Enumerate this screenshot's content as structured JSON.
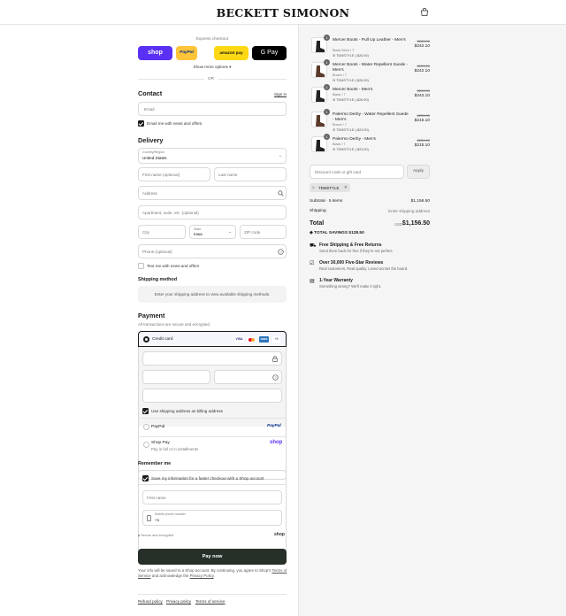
{
  "header": {
    "logo": "BECKETT SIMONON"
  },
  "express": {
    "title": "Express checkout",
    "shop": "shop",
    "paypal": "PayPal",
    "amazon": "amazon pay",
    "gpay": "G Pay",
    "more": "Show more options",
    "or": "OR"
  },
  "contact": {
    "title": "Contact",
    "signin": "Sign in",
    "email_placeholder": "Email",
    "news": "Email me with news and offers"
  },
  "delivery": {
    "title": "Delivery",
    "country_label": "Country/Region",
    "country": "United States",
    "first": "First name (optional)",
    "last": "Last name",
    "address": "Address",
    "apt": "Apartment, suite, etc. (optional)",
    "city": "City",
    "state_label": "State",
    "state": "Iowa",
    "zip": "ZIP code",
    "phone": "Phone (optional)",
    "text_news": "Text me with news and offers"
  },
  "shipping": {
    "title": "Shipping method",
    "note": "Enter your shipping address to view available shipping methods."
  },
  "payment": {
    "title": "Payment",
    "sub": "All transactions are secure and encrypted.",
    "credit": "Credit card",
    "visa": "VISA",
    "amex": "AMEX",
    "more_cards": "+5",
    "billing": "Use shipping address as billing address",
    "paypal": "PayPal",
    "paypal_logo": "PayPal",
    "shoppay": "Shop Pay",
    "shoppay_sub": "Pay in full or in installments",
    "shoppay_logo": "shop"
  },
  "remember": {
    "title": "Remember me",
    "save": "Save my information for a faster checkout with a Shop account",
    "first": "First name",
    "mobile_label": "Mobile phone number",
    "mobile": "+1",
    "secure": "Secure and encrypted",
    "shop": "shop"
  },
  "pay_button": "Pay now",
  "legal": {
    "text1": "Your info will be saved to a Shop account. By continuing, you agree to Shop's",
    "tos": "Terms of Service",
    "and": "and acknowledge the",
    "privacy": "Privacy Policy",
    "dot": "."
  },
  "footer": {
    "refund": "Refund policy",
    "privacy": "Privacy policy",
    "terms": "Terms of service"
  },
  "items": [
    {
      "name": "Mercer Boots - Pull Up Leather - Men's",
      "variant": "Black Mohr / 7",
      "discount": "TDMSTYLE (-$26.90)",
      "old": "$269.00",
      "price": "$242.10",
      "qty": "1"
    },
    {
      "name": "Mercer Boots - Water Repellent Suede - Men's",
      "variant": "Brown / 7",
      "discount": "TDMSTYLE (-$26.90)",
      "old": "$269.00",
      "price": "$242.10",
      "qty": "1"
    },
    {
      "name": "Mercer Boots - Men's",
      "variant": "Black / 7",
      "discount": "TDMSTYLE (-$26.90)",
      "old": "$269.00",
      "price": "$242.10",
      "qty": "1"
    },
    {
      "name": "Palermo Derby - Water Repellent Suede - Men's",
      "variant": "Brown / 7",
      "discount": "TDMSTYLE (-$23.90)",
      "old": "$239.00",
      "price": "$215.10",
      "qty": "1"
    },
    {
      "name": "Palermo Derby - Men's",
      "variant": "Black / 7",
      "discount": "TDMSTYLE (-$23.90)",
      "old": "$239.00",
      "price": "$215.10",
      "qty": "1"
    }
  ],
  "summary": {
    "discount_placeholder": "Discount code or gift card",
    "apply": "Apply",
    "code": "TDMSTYLE",
    "subtotal_label": "Subtotal · 5 items",
    "subtotal": "$1,156.50",
    "shipping_label": "Shipping",
    "shipping": "Enter shipping address",
    "total_label": "Total",
    "currency": "USD",
    "total": "$1,156.50",
    "savings_label": "TOTAL SAVINGS",
    "savings": "$128.50"
  },
  "perks": [
    {
      "title": "Free Shipping & Free Returns",
      "sub": "Send them back for free if they're not perfect."
    },
    {
      "title": "Over 30,000 Five-Star Reviews",
      "sub": "Real customers. Real quality. Loved across the board."
    },
    {
      "title": "1-Year Warranty",
      "sub": "Something wrong? We'll make it right."
    }
  ],
  "colors": {
    "shop": "#5a31f4",
    "paypal": "#ffc439",
    "amazon": "#ffd814",
    "gpay": "#000000",
    "pay_button": "#263029",
    "check": "#1a1a1a"
  }
}
